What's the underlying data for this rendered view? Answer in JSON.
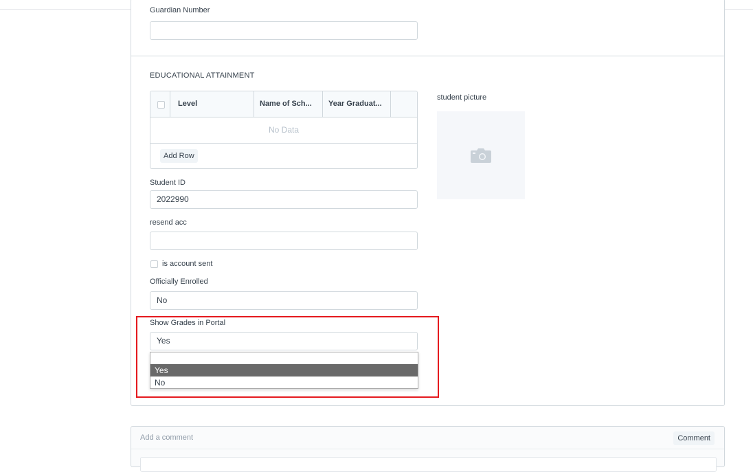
{
  "form": {
    "guardian_number": {
      "label": "Guardian Number",
      "value": ""
    },
    "educational_attainment": {
      "title": "EDUCATIONAL ATTAINMENT",
      "columns": [
        "Level",
        "Name of Sch...",
        "Year Graduat..."
      ],
      "empty_text": "No Data",
      "add_row_label": "Add Row"
    },
    "student_picture": {
      "label": "student picture",
      "icon": "camera-icon"
    },
    "student_id": {
      "label": "Student ID",
      "value": "2022990"
    },
    "resend_acc": {
      "label": "resend acc",
      "value": ""
    },
    "is_account_sent": {
      "label": "is account sent",
      "checked": false
    },
    "officially_enrolled": {
      "label": "Officially Enrolled",
      "value": "No"
    },
    "show_grades": {
      "label": "Show Grades in Portal",
      "value": "Yes",
      "options": [
        "",
        "Yes",
        "No"
      ],
      "highlighted_option": "Yes"
    }
  },
  "comment": {
    "placeholder": "Add a comment",
    "button_label": "Comment"
  },
  "colors": {
    "highlight_border": "#e5191e",
    "selected_option_bg": "#696969"
  }
}
